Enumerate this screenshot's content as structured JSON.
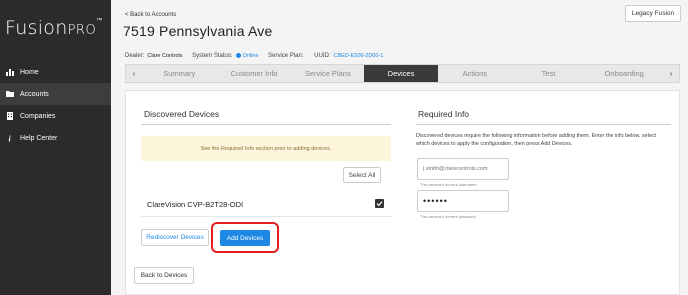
{
  "sidebar": {
    "logo_main": "Fusion",
    "logo_pro": "PRO",
    "logo_tm": "™",
    "items": [
      {
        "label": "Home",
        "icon": "bar-chart-icon"
      },
      {
        "label": "Accounts",
        "icon": "folder-icon",
        "active": true
      },
      {
        "label": "Companies",
        "icon": "building-icon"
      },
      {
        "label": "Help Center",
        "icon": "info-icon"
      }
    ]
  },
  "header": {
    "back_label": "< Back to Accounts",
    "title": "7519 Pennsylvania Ave",
    "legacy_label": "Legacy Fusion"
  },
  "meta": {
    "dealer_label": "Dealer:",
    "dealer_value": "Clare Controls",
    "status_label": "System Status:",
    "status_value": "Online",
    "plan_label": "Service Plan:",
    "plan_value": "",
    "uuid_label": "UUID:",
    "uuid_value": "CBED-E506-2D00-1"
  },
  "tabs": [
    "Summary",
    "Customer Info",
    "Service Plans",
    "Devices",
    "Actions",
    "Test",
    "Onboarding"
  ],
  "active_tab": "Devices",
  "discovered": {
    "title": "Discovered Devices",
    "notice": "See the Required Info section prior to adding devices.",
    "select_all": "Select All",
    "device_name": "ClareVision CVP-B2T28-ODI",
    "device_checked": true,
    "rediscover": "Rediscover Devices",
    "add_devices": "Add Devices",
    "back": "Back to Devices"
  },
  "required": {
    "title": "Required Info",
    "description": "Discovered devices require the following information before adding them. Enter the info below, select which devices to apply the configuration, then press Add Devices.",
    "username_placeholder": "j.smith@clarecontrols.com",
    "username_help": "The camera's current username",
    "password_value": "••••••",
    "password_help": "The camera's current password"
  },
  "colors": {
    "sidebar_bg": "#2b2b2b",
    "accent": "#1e88e5",
    "highlight": "#e02020",
    "notice_bg": "#fdf6dc"
  }
}
